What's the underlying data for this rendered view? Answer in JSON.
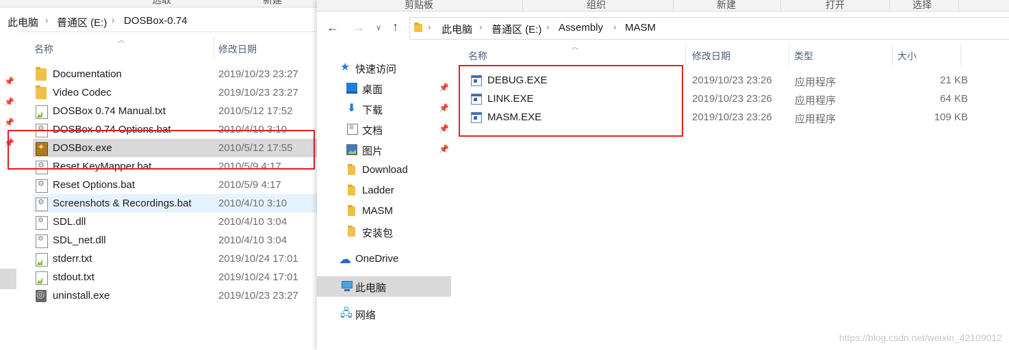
{
  "left": {
    "ribbon_tabs": [
      "选取",
      "新建"
    ],
    "breadcrumb": [
      "此电脑",
      "普通区 (E:)",
      "DOSBox-0.74"
    ],
    "columns": {
      "name": "名称",
      "date": "修改日期"
    },
    "files": [
      {
        "name": "Documentation",
        "date": "2019/10/23 23:27",
        "icon": "folder-icon"
      },
      {
        "name": "Video Codec",
        "date": "2019/10/23 23:27",
        "icon": "folder-icon"
      },
      {
        "name": "DOSBox 0.74 Manual.txt",
        "date": "2010/5/12 17:52",
        "icon": "text-file-icon"
      },
      {
        "name": "DOSBox 0.74 Options.bat",
        "date": "2010/4/10 3:10",
        "icon": "batch-file-icon"
      },
      {
        "name": "DOSBox.exe",
        "date": "2010/5/12 17:55",
        "icon": "dosbox-app-icon"
      },
      {
        "name": "Reset KeyMapper.bat",
        "date": "2010/5/9 4:17",
        "icon": "batch-file-icon"
      },
      {
        "name": "Reset Options.bat",
        "date": "2010/5/9 4:17",
        "icon": "batch-file-icon"
      },
      {
        "name": "Screenshots & Recordings.bat",
        "date": "2010/4/10 3:10",
        "icon": "batch-file-icon"
      },
      {
        "name": "SDL.dll",
        "date": "2010/4/10 3:04",
        "icon": "dll-file-icon"
      },
      {
        "name": "SDL_net.dll",
        "date": "2010/4/10 3:04",
        "icon": "dll-file-icon"
      },
      {
        "name": "stderr.txt",
        "date": "2019/10/24 17:01",
        "icon": "text-file-icon"
      },
      {
        "name": "stdout.txt",
        "date": "2019/10/24 17:01",
        "icon": "text-file-icon"
      },
      {
        "name": "uninstall.exe",
        "date": "2019/10/23 23:27",
        "icon": "uninstall-icon"
      }
    ]
  },
  "right": {
    "ribbon_groups": [
      "剪贴板",
      "组织",
      "新建",
      "打开",
      "选择"
    ],
    "breadcrumb": [
      "此电脑",
      "普通区 (E:)",
      "Assembly",
      "MASM"
    ],
    "nav": [
      {
        "label": "快速访问",
        "icon": "star-icon"
      },
      {
        "label": "桌面",
        "icon": "desktop-icon",
        "pinned": true
      },
      {
        "label": "下载",
        "icon": "download-icon",
        "pinned": true
      },
      {
        "label": "文档",
        "icon": "document-icon",
        "pinned": true
      },
      {
        "label": "图片",
        "icon": "picture-icon",
        "pinned": true
      },
      {
        "label": "Download",
        "icon": "folder-icon"
      },
      {
        "label": "Ladder",
        "icon": "folder-icon"
      },
      {
        "label": "MASM",
        "icon": "folder-icon"
      },
      {
        "label": "安装包",
        "icon": "folder-icon"
      },
      {
        "label": "OneDrive",
        "icon": "onedrive-icon"
      },
      {
        "label": "此电脑",
        "icon": "this-pc-icon",
        "selected": true
      },
      {
        "label": "网络",
        "icon": "network-icon"
      }
    ],
    "columns": {
      "name": "名称",
      "date": "修改日期",
      "type": "类型",
      "size": "大小"
    },
    "files": [
      {
        "name": "DEBUG.EXE",
        "date": "2019/10/23 23:26",
        "type": "应用程序",
        "size": "21 KB"
      },
      {
        "name": "LINK.EXE",
        "date": "2019/10/23 23:26",
        "type": "应用程序",
        "size": "64 KB"
      },
      {
        "name": "MASM.EXE",
        "date": "2019/10/23 23:26",
        "type": "应用程序",
        "size": "109 KB"
      }
    ]
  },
  "watermark": "https://blog.csdn.net/weixin_42109012",
  "colors": {
    "highlight_box": "#e02020",
    "selected_row": "#d9d9d9",
    "hover_row": "#e5f3ff",
    "header_text": "#4c607a"
  }
}
